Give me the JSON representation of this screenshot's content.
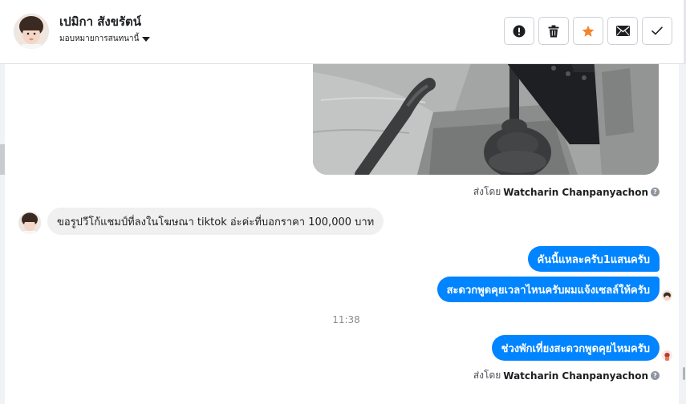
{
  "header": {
    "contact_name": "เปมิกา สังขรัตน์",
    "assign_label": "มอบหมายการสนทนานี้",
    "actions": [
      {
        "name": "report-button",
        "icon": "exclamation-circle-icon"
      },
      {
        "name": "delete-button",
        "icon": "trash-icon"
      },
      {
        "name": "star-button",
        "icon": "star-icon",
        "color": "#f5842b"
      },
      {
        "name": "mark-unread-button",
        "icon": "envelope-icon"
      },
      {
        "name": "mark-done-button",
        "icon": "check-icon"
      }
    ]
  },
  "thread": {
    "sent_by_prefix": "ส่งโดย",
    "sender_name": "Watcharin Chanpanyachon",
    "incoming_message": "ขอรูปวีโก้แชมป์ที่ลงในโฆษณา tiktok อ่ะค่ะที่บอกราคา 100,000 บาท",
    "outgoing_messages": [
      "คันนี้แหละครับ1แสนครับ",
      "สะดวกพูดคุยเวลาไหนครับผมแจ้งเซลล์ให้ครับ",
      "ช่วงพักเที่ยงสะดวกพูดคุยไหมครับ"
    ],
    "timestamp": "11:38"
  },
  "colors": {
    "outgoing_bubble": "#0084ff",
    "incoming_bubble": "#f0f0f0",
    "star": "#f5842b"
  }
}
